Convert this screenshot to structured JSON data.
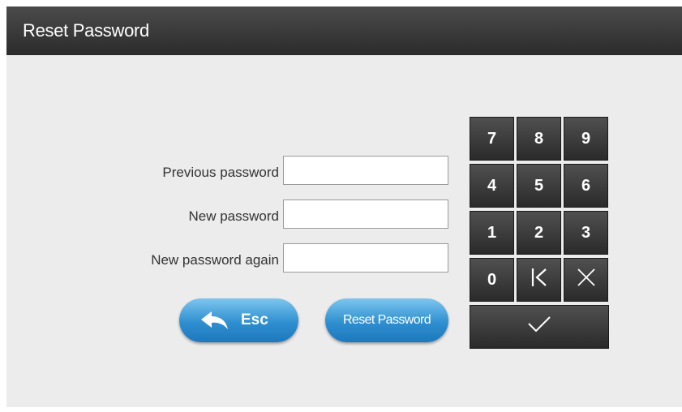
{
  "window": {
    "title": "Reset Password"
  },
  "form": {
    "previous_password_label": "Previous password",
    "new_password_label": "New password",
    "new_password_again_label": "New password again",
    "previous_password_value": "",
    "new_password_value": "",
    "new_password_again_value": ""
  },
  "buttons": {
    "esc_label": "Esc",
    "esc_icon": "back-arrow-icon",
    "reset_label": "Reset Password"
  },
  "keypad": {
    "keys": [
      "7",
      "8",
      "9",
      "4",
      "5",
      "6",
      "1",
      "2",
      "3",
      "0"
    ],
    "backspace_icon": "backspace-icon",
    "clear_icon": "clear-icon",
    "confirm_icon": "checkmark-icon"
  },
  "colors": {
    "titlebar": "#3a3a3a",
    "background": "#ececec",
    "button_blue": "#2f8fd0",
    "key_dark": "#333333"
  }
}
